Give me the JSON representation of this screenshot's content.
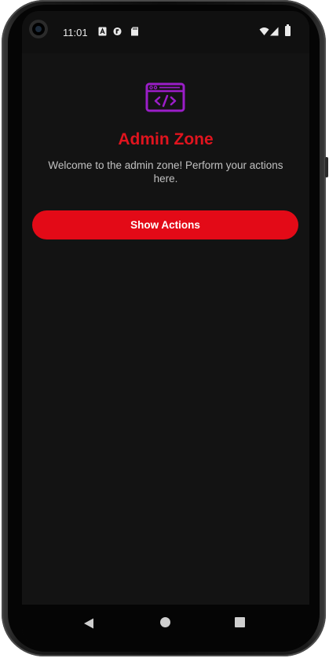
{
  "status_bar": {
    "time": "11:01",
    "notification_icons": [
      "a-box-icon",
      "photos-icon",
      "sd-card-icon"
    ],
    "right_icons": [
      "wifi-icon",
      "signal-icon",
      "battery-icon"
    ]
  },
  "main": {
    "logo_icon": "code-window-icon",
    "title": "Admin Zone",
    "subtitle": "Welcome to the admin zone! Perform your actions here.",
    "show_actions_label": "Show Actions"
  },
  "colors": {
    "accent": "#e30a17",
    "title": "#e0141e",
    "logo": "#9b1ec8",
    "background": "#131313"
  },
  "nav_bar": {
    "buttons": [
      "back-icon",
      "home-icon",
      "recents-icon"
    ]
  }
}
